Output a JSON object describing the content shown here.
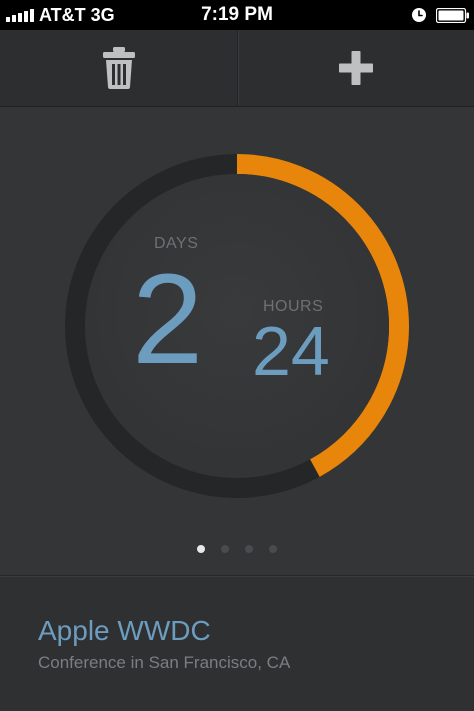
{
  "status_bar": {
    "carrier": "AT&T 3G",
    "time": "7:19 PM",
    "signal_bars": 5,
    "icons": [
      "signal-bars-icon",
      "alarm-clock-icon",
      "battery-icon"
    ]
  },
  "toolbar": {
    "delete_icon": "trash-icon",
    "add_icon": "plus-icon"
  },
  "countdown": {
    "days_label": "DAYS",
    "days_value": "2",
    "hours_label": "HOURS",
    "hours_value": "24",
    "progress_fraction": 0.42,
    "progress_color": "#e8860c",
    "track_color": "#252628",
    "number_color": "#6c9dbf"
  },
  "pagination": {
    "count": 4,
    "active_index": 0
  },
  "event": {
    "title": "Apple WWDC",
    "subtitle": "Conference in San Francisco, CA"
  }
}
